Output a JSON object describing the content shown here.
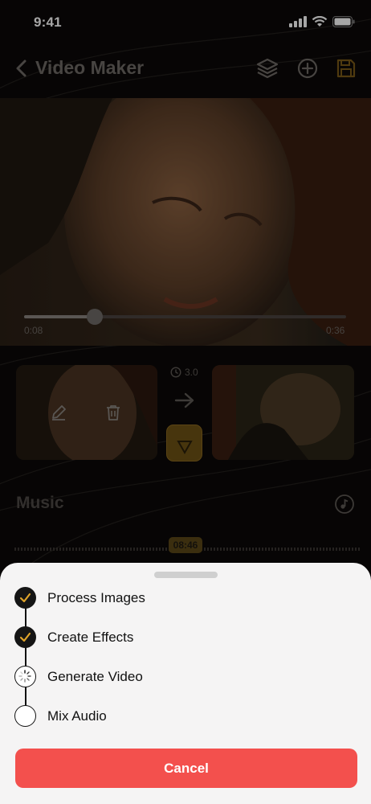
{
  "status_bar": {
    "time": "9:41"
  },
  "nav": {
    "title": "Video Maker"
  },
  "player": {
    "current_time": "0:08",
    "total_time": "0:36",
    "progress": 0.22
  },
  "transition": {
    "duration": "3.0"
  },
  "music": {
    "title": "Music",
    "timestamp": "08:46"
  },
  "progress_sheet": {
    "steps": [
      {
        "label": "Process Images",
        "state": "done"
      },
      {
        "label": "Create Effects",
        "state": "done"
      },
      {
        "label": "Generate Video",
        "state": "in-progress"
      },
      {
        "label": "Mix Audio",
        "state": "pending"
      }
    ],
    "cancel_label": "Cancel"
  },
  "colors": {
    "accent": "#e0a42a",
    "cancel": "#f3504d"
  }
}
